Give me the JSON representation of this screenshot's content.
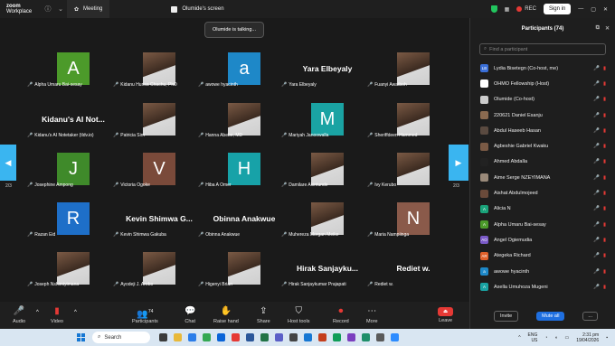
{
  "titlebar": {
    "logo_line1": "zoom",
    "logo_line2": "Workplace",
    "tab_meeting": "Meeting",
    "tab_share": "Olumide's screen",
    "rec_label": "REC",
    "signin_label": "Sign in"
  },
  "meeting": {
    "talking_text": "Olumide is talking...",
    "page_left": "2/3",
    "page_right": "2/3",
    "tiles": [
      {
        "label": "Alpha Umaru Bai-sesay",
        "type": "letter",
        "letter": "A",
        "color": "#4c9a2a"
      },
      {
        "label": "Kidanu Hurisa Chachu, PhD",
        "type": "photo"
      },
      {
        "label": "awowe hyacinth",
        "type": "letter",
        "letter": "a",
        "color": "#1e88c8"
      },
      {
        "label": "Yara Elbeyaly",
        "type": "name",
        "big": "Yara Elbeyaly"
      },
      {
        "label": "Fuanyi Awatboh",
        "type": "photo"
      },
      {
        "label": "Kidanu's AI Notetaker (tldv.io)",
        "type": "name",
        "big": "Kidanu's AI Not..."
      },
      {
        "label": "Patricia Sim",
        "type": "photo"
      },
      {
        "label": "Hanna Abebe, MD",
        "type": "photo"
      },
      {
        "label": "Mariyah Janoowalla",
        "type": "letter",
        "letter": "M",
        "color": "#1aa3a3"
      },
      {
        "label": "Sheriffdeen Hammed",
        "type": "photo"
      },
      {
        "label": "Josephine Ampong",
        "type": "letter",
        "letter": "J",
        "color": "#3f8a2a"
      },
      {
        "label": "Victoria Ogoke",
        "type": "letter",
        "letter": "V",
        "color": "#7a4a3a"
      },
      {
        "label": "Hiba A Omer",
        "type": "letter",
        "letter": "H",
        "color": "#17a2a8"
      },
      {
        "label": "Damilare Akintunde",
        "type": "photo"
      },
      {
        "label": "Ivy Kerubo",
        "type": "photo"
      },
      {
        "label": "Razan Eid",
        "type": "letter",
        "letter": "R",
        "color": "#1e6fc8"
      },
      {
        "label": "Kevin Shimwa Gakuba",
        "type": "name",
        "big": "Kevin Shimwa G..."
      },
      {
        "label": "Obinna Anakwue",
        "type": "name",
        "big": "Obinna Anakwue"
      },
      {
        "label": "Muhereza Morgan Meike",
        "type": "photo"
      },
      {
        "label": "Maria Nampiinga",
        "type": "letter",
        "letter": "N",
        "color": "#8a5a4a"
      },
      {
        "label": "Joseph Nshimiyimana",
        "type": "photo"
      },
      {
        "label": "Ayodeji J. Arobo",
        "type": "photo"
      },
      {
        "label": "Higenyi Brian",
        "type": "photo"
      },
      {
        "label": "Hirak Sanjaykumar Prajapati",
        "type": "name",
        "big": "Hirak Sanjayku..."
      },
      {
        "label": "Rediet w.",
        "type": "name",
        "big": "Rediet w."
      }
    ]
  },
  "toolbar": {
    "audio": "Audio",
    "video": "Video",
    "participants": "Participants",
    "participants_count": "74",
    "chat": "Chat",
    "raise_hand": "Raise hand",
    "share": "Share",
    "host_tools": "Host tools",
    "record": "Record",
    "more": "More",
    "leave": "Leave"
  },
  "panel": {
    "title": "Participants (74)",
    "search_placeholder": "Find a participant",
    "invite": "Invite",
    "mute_all": "Mute all",
    "more": "...",
    "participants": [
      {
        "name": "Lydia Bisetegn (Co-host, me)",
        "initials": "LB",
        "color": "#3a6fd8"
      },
      {
        "name": "OHMO Fellowship (Host)",
        "initials": "",
        "color": "#ffffff"
      },
      {
        "name": "Olumide (Co-host)",
        "initials": "",
        "color": "#cccccc"
      },
      {
        "name": "220621 Daniel Esanju",
        "initials": "",
        "color": "#8a6a50"
      },
      {
        "name": "Abdul Haseeb Hasan",
        "initials": "",
        "color": "#5a4a40"
      },
      {
        "name": "Agbeshie Gabriel Kwaku",
        "initials": "",
        "color": "#7a5a45"
      },
      {
        "name": "Ahmed Abdalla",
        "initials": "",
        "color": "#222222"
      },
      {
        "name": "Aime Serge NZEYIMANA",
        "initials": "",
        "color": "#9a8a7a"
      },
      {
        "name": "Aishat Abdulmojeed",
        "initials": "",
        "color": "#6a4a3a"
      },
      {
        "name": "Alicia N",
        "initials": "A",
        "color": "#1aa37a"
      },
      {
        "name": "Alpha Umaru Bai-sesay",
        "initials": "A",
        "color": "#4c9a2a"
      },
      {
        "name": "Angel Ogiemudia",
        "initials": "AO",
        "color": "#7a5ac8"
      },
      {
        "name": "Ategeka Richard",
        "initials": "AR",
        "color": "#e0602a"
      },
      {
        "name": "awowe hyacinth",
        "initials": "a",
        "color": "#1e88c8"
      },
      {
        "name": "Axella Umuhoza Mugeni",
        "initials": "A",
        "color": "#1aa3a3"
      }
    ]
  },
  "taskbar": {
    "search": "Search",
    "lang_top": "ENG",
    "lang_bottom": "US",
    "time": "2:31 pm",
    "date": "19/04/2026"
  }
}
